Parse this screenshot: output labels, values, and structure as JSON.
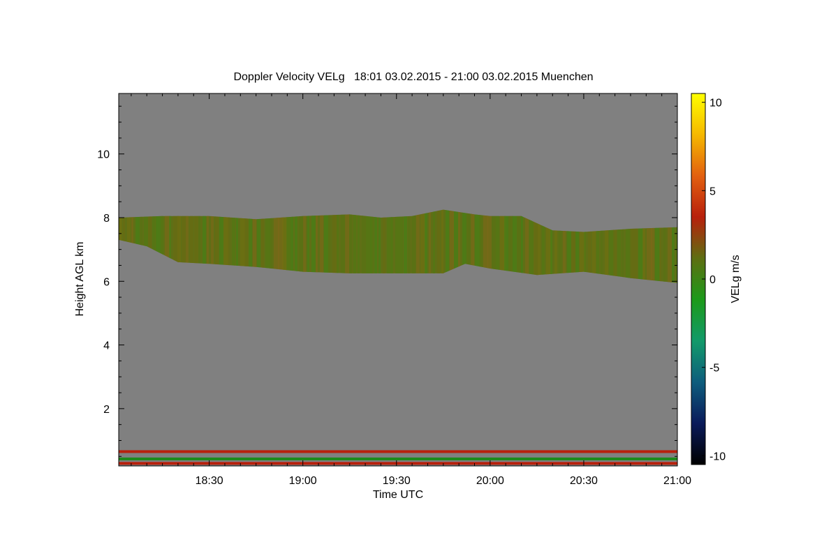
{
  "chart_data": {
    "type": "heatmap",
    "title": "Doppler Velocity VELg   18:01 03.02.2015 - 21:00 03.02.2015 Muenchen",
    "xlabel": "Time UTC",
    "ylabel": "Height AGL km",
    "xlim": [
      "18:01",
      "21:00"
    ],
    "ylim": [
      0.2,
      11.9
    ],
    "x_ticks": [
      "18:30",
      "19:00",
      "19:30",
      "20:00",
      "20:30",
      "21:00"
    ],
    "y_ticks": [
      "2",
      "4",
      "6",
      "8",
      "10"
    ],
    "colorbar": {
      "label": "VELg m/s",
      "range": [
        -10.5,
        10.5
      ],
      "ticks": [
        "-10",
        "-5",
        "0",
        "5",
        "10"
      ],
      "colors": [
        "#000000",
        "#0a1a5a",
        "#0e5d7d",
        "#129a6a",
        "#1c9a1a",
        "#5e6e12",
        "#b8200c",
        "#e26010",
        "#f5b800",
        "#ffff00"
      ]
    },
    "background_color": "#808080",
    "cloud_layer": {
      "description_values": "velocity approx -2 to 1 m/s",
      "top_km": [
        [
          "18:01",
          8.0
        ],
        [
          "18:15",
          8.05
        ],
        [
          "18:30",
          8.05
        ],
        [
          "18:45",
          7.95
        ],
        [
          "19:00",
          8.05
        ],
        [
          "19:15",
          8.1
        ],
        [
          "19:25",
          8.0
        ],
        [
          "19:35",
          8.05
        ],
        [
          "19:45",
          8.25
        ],
        [
          "19:55",
          8.1
        ],
        [
          "20:00",
          8.05
        ],
        [
          "20:10",
          8.05
        ],
        [
          "20:20",
          7.6
        ],
        [
          "20:30",
          7.55
        ],
        [
          "20:45",
          7.65
        ],
        [
          "21:00",
          7.7
        ]
      ],
      "base_km": [
        [
          "18:01",
          7.3
        ],
        [
          "18:10",
          7.1
        ],
        [
          "18:20",
          6.6
        ],
        [
          "18:30",
          6.55
        ],
        [
          "18:45",
          6.45
        ],
        [
          "19:00",
          6.3
        ],
        [
          "19:15",
          6.25
        ],
        [
          "19:30",
          6.25
        ],
        [
          "19:45",
          6.25
        ],
        [
          "19:52",
          6.55
        ],
        [
          "20:00",
          6.4
        ],
        [
          "20:15",
          6.2
        ],
        [
          "20:30",
          6.3
        ],
        [
          "20:45",
          6.1
        ],
        [
          "21:00",
          5.95
        ]
      ]
    },
    "near_ground_bands_km": [
      {
        "height": 0.65,
        "velocity": 2.5
      },
      {
        "height": 0.42,
        "velocity": -1.5
      },
      {
        "height": 0.28,
        "velocity": 2.0
      }
    ]
  }
}
